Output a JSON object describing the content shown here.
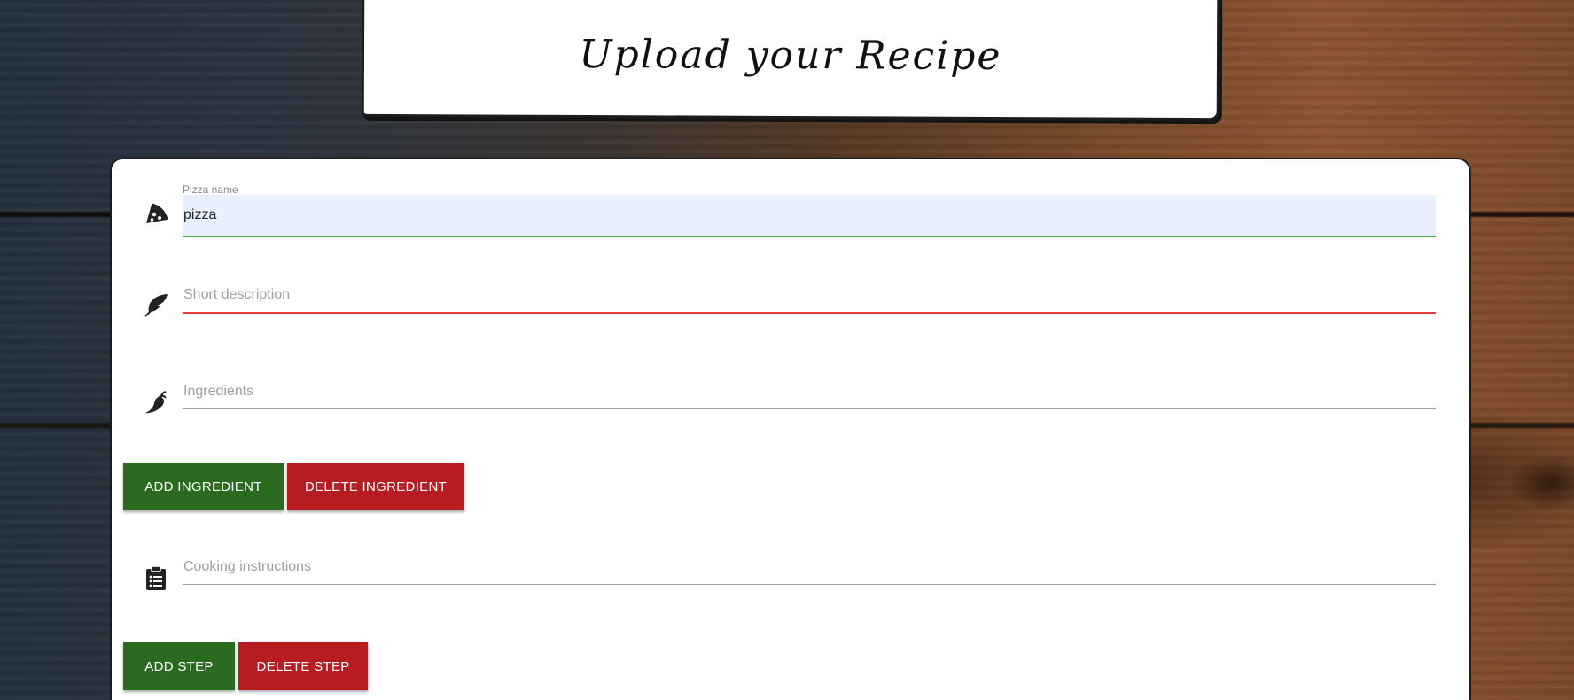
{
  "header": {
    "title": "Upload your Recipe"
  },
  "form": {
    "pizza_name": {
      "label": "Pizza name",
      "value": "pizza",
      "icon": "pizza-slice-icon"
    },
    "short_description": {
      "placeholder": "Short description",
      "icon": "feather-icon"
    },
    "ingredients": {
      "placeholder": "Ingredients",
      "icon": "pepper-icon"
    },
    "cooking_instructions": {
      "placeholder": "Cooking instructions",
      "icon": "clipboard-list-icon"
    },
    "buttons": {
      "add_ingredient": "ADD INGREDIENT",
      "delete_ingredient": "DELETE INGREDIENT",
      "add_step": "ADD STEP",
      "delete_step": "DELETE STEP"
    }
  },
  "colors": {
    "add_button": "#2a6b1f",
    "delete_button": "#b71c22",
    "valid_underline": "#4caf50",
    "invalid_underline": "#e53935",
    "autofill_background": "#e8f0fe"
  }
}
